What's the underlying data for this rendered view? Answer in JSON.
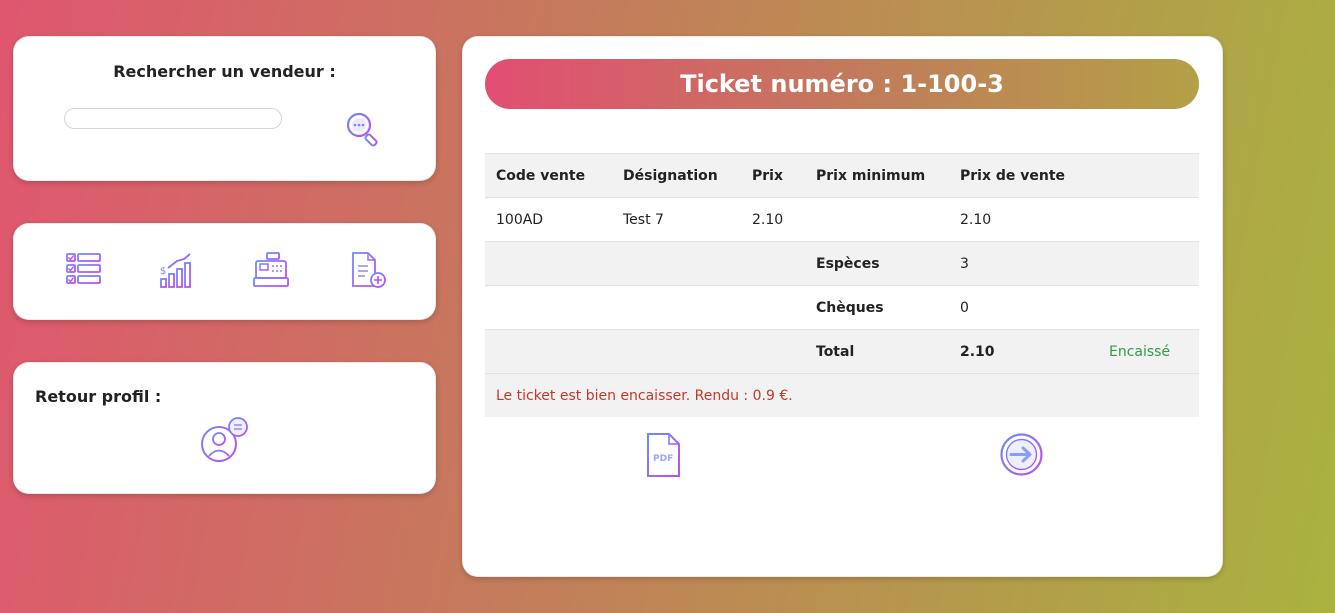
{
  "search": {
    "title": "Rechercher un vendeur :",
    "placeholder": "",
    "value": ""
  },
  "icons": {
    "search": "search-magnifier-icon",
    "nav": [
      "checklist-icon",
      "sales-chart-icon",
      "cash-register-icon",
      "add-document-icon"
    ],
    "profile": "user-chat-icon",
    "pdf": "pdf-file-icon",
    "next": "arrow-right-circle-icon"
  },
  "profile": {
    "title": "Retour profil :"
  },
  "ticket": {
    "title": "Ticket numéro : 1-100-3",
    "columns": [
      "Code vente",
      "Désignation",
      "Prix",
      "Prix minimum",
      "Prix de vente"
    ],
    "rows": [
      {
        "code": "100AD",
        "designation": "Test 7",
        "prix": "2.10",
        "prix_min": "",
        "prix_vente": "2.10"
      }
    ],
    "especes_label": "Espèces",
    "especes_value": "3",
    "cheques_label": "Chèques",
    "cheques_value": "0",
    "total_label": "Total",
    "total_value": "2.10",
    "status": "Encaissé",
    "message": "Le ticket est bien encaisser. Rendu : 0.9 €."
  },
  "colors": {
    "accent_purple": "#a855f7",
    "accent_blue": "#6b8cff",
    "status_green": "#2f9e44",
    "message_red": "#c0392b"
  }
}
